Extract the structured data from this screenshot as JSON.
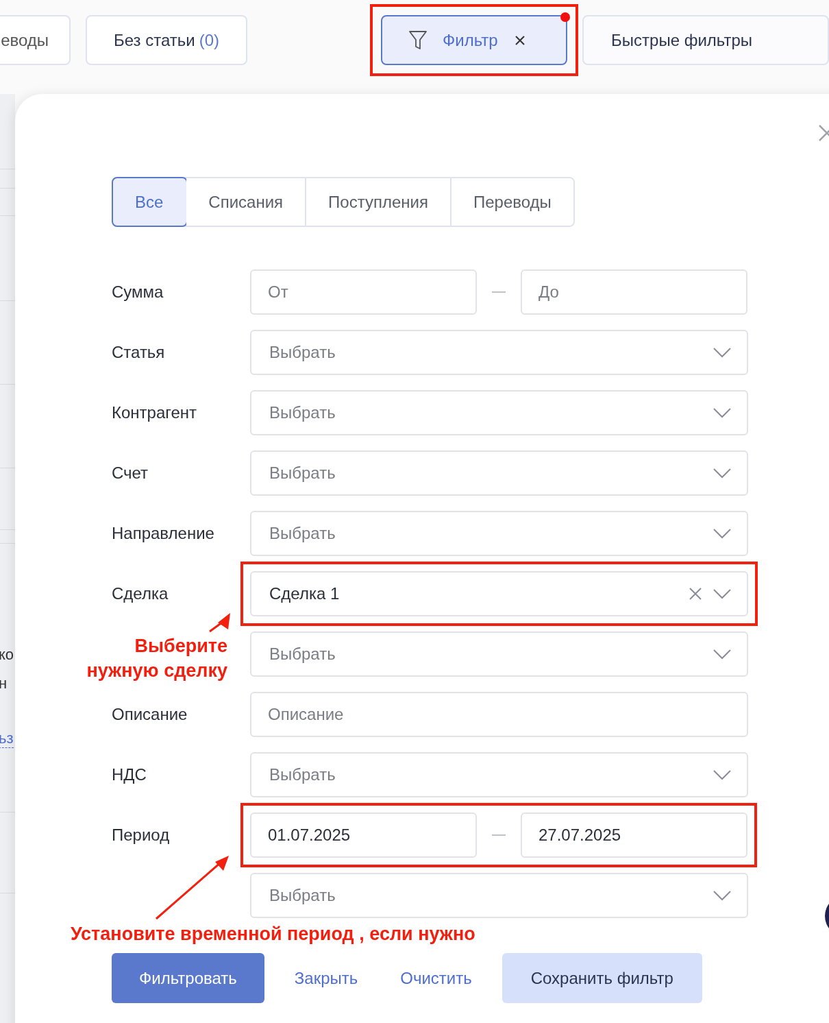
{
  "toolbar": [
    {
      "kind": "plain",
      "label": "еводы",
      "selected": false
    },
    {
      "kind": "count",
      "label": "Без статьи",
      "count": "(0)",
      "selected": false
    },
    {
      "kind": "filter",
      "label": "Фильтр",
      "selected": true,
      "highlighted": true,
      "indicator": true
    },
    {
      "kind": "plain",
      "label": "Быстрые фильтры",
      "selected": false
    }
  ],
  "background_fragments": [
    {
      "kind": "text",
      "text": "ко"
    },
    {
      "kind": "text",
      "text": "н"
    },
    {
      "kind": "link",
      "text": "ьз"
    }
  ],
  "panel": {
    "tabs": [
      {
        "label": "Все",
        "selected": true
      },
      {
        "label": "Списания",
        "selected": false
      },
      {
        "label": "Поступления",
        "selected": false
      },
      {
        "label": "Переводы",
        "selected": false
      }
    ],
    "rows": [
      {
        "label": "Сумма",
        "kind": "range",
        "from": {
          "placeholder": "От"
        },
        "to": {
          "placeholder": "До"
        },
        "highlighted": false
      },
      {
        "label": "Статья",
        "kind": "select",
        "placeholder": "Выбрать",
        "clearable": false,
        "highlighted": false
      },
      {
        "label": "Контрагент",
        "kind": "select",
        "placeholder": "Выбрать",
        "clearable": false,
        "highlighted": false
      },
      {
        "label": "Счет",
        "kind": "select",
        "placeholder": "Выбрать",
        "clearable": false,
        "highlighted": false
      },
      {
        "label": "Направление",
        "kind": "select",
        "placeholder": "Выбрать",
        "clearable": false,
        "highlighted": false
      },
      {
        "label": "Сделка",
        "kind": "select",
        "value": "Сделка 1",
        "clearable": true,
        "highlighted": true
      },
      {
        "kind": "select",
        "placeholder": "Выбрать",
        "clearable": false,
        "highlighted": false
      },
      {
        "label": "Описание",
        "kind": "text",
        "placeholder": "Описание",
        "highlighted": false
      },
      {
        "label": "НДС",
        "kind": "select",
        "placeholder": "Выбрать",
        "clearable": false,
        "highlighted": false
      },
      {
        "label": "Период",
        "kind": "range",
        "from": {
          "value": "01.07.2025"
        },
        "to": {
          "value": "27.07.2025"
        },
        "highlighted": true
      },
      {
        "kind": "select",
        "placeholder": "Выбрать",
        "clearable": false,
        "highlighted": false
      }
    ],
    "buttons": [
      {
        "kind": "primary",
        "label": "Фильтровать"
      },
      {
        "kind": "link",
        "label": "Закрыть"
      },
      {
        "kind": "link",
        "label": "Очистить"
      },
      {
        "kind": "secondary",
        "label": "Сохранить фильтр"
      }
    ]
  },
  "annotations": [
    {
      "kind": "callout",
      "text": "Выберите нужную сделку"
    },
    {
      "kind": "callout",
      "text": "Установите временной период , если нужно"
    }
  ]
}
